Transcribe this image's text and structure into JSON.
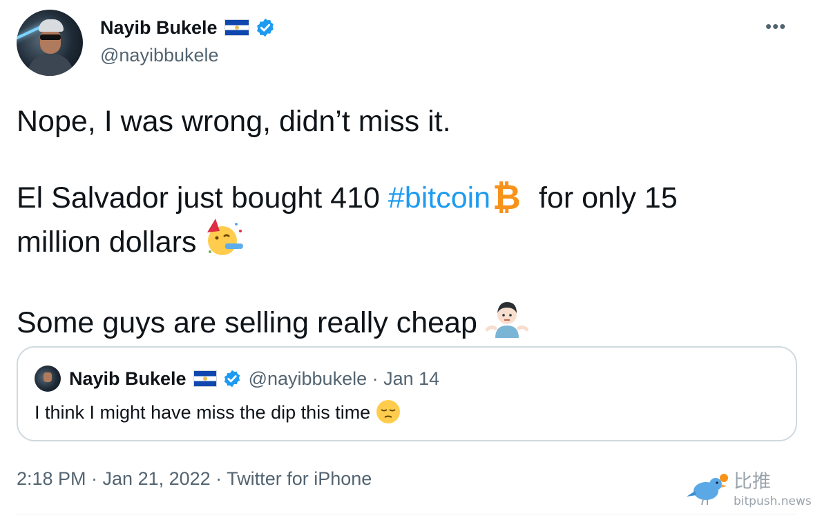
{
  "author": {
    "name": "Nayib Bukele",
    "handle": "@nayibbukele",
    "flag_colors": [
      "#0f47af",
      "#ffffff",
      "#0f47af"
    ],
    "verified_color": "#1d9bf0"
  },
  "more_label": "•••",
  "tweet": {
    "line1": "Nope, I was wrong, didn’t miss it.",
    "line2_before": "El Salvador just bought 410 ",
    "hashtag": "#bitcoin",
    "line2_after": "  for only 15",
    "line3": "million dollars",
    "line4": "Some guys are selling really cheap",
    "emojis": [
      "bitcoin-icon",
      "partying-face-icon",
      "person-shrugging-icon"
    ]
  },
  "quoted": {
    "name": "Nayib Bukele",
    "handle_date": "@nayibbukele · Jan 14",
    "text": "I think I might have miss the dip this time",
    "emoji": "pensive-face-icon"
  },
  "meta": "2:18 PM · Jan 21, 2022 · Twitter for iPhone",
  "watermark": {
    "cn": "比推",
    "url": "bitpush.news"
  },
  "colors": {
    "hashtag": "#1d9bf0",
    "secondary_text": "#536471",
    "border": "#cfd9de"
  }
}
